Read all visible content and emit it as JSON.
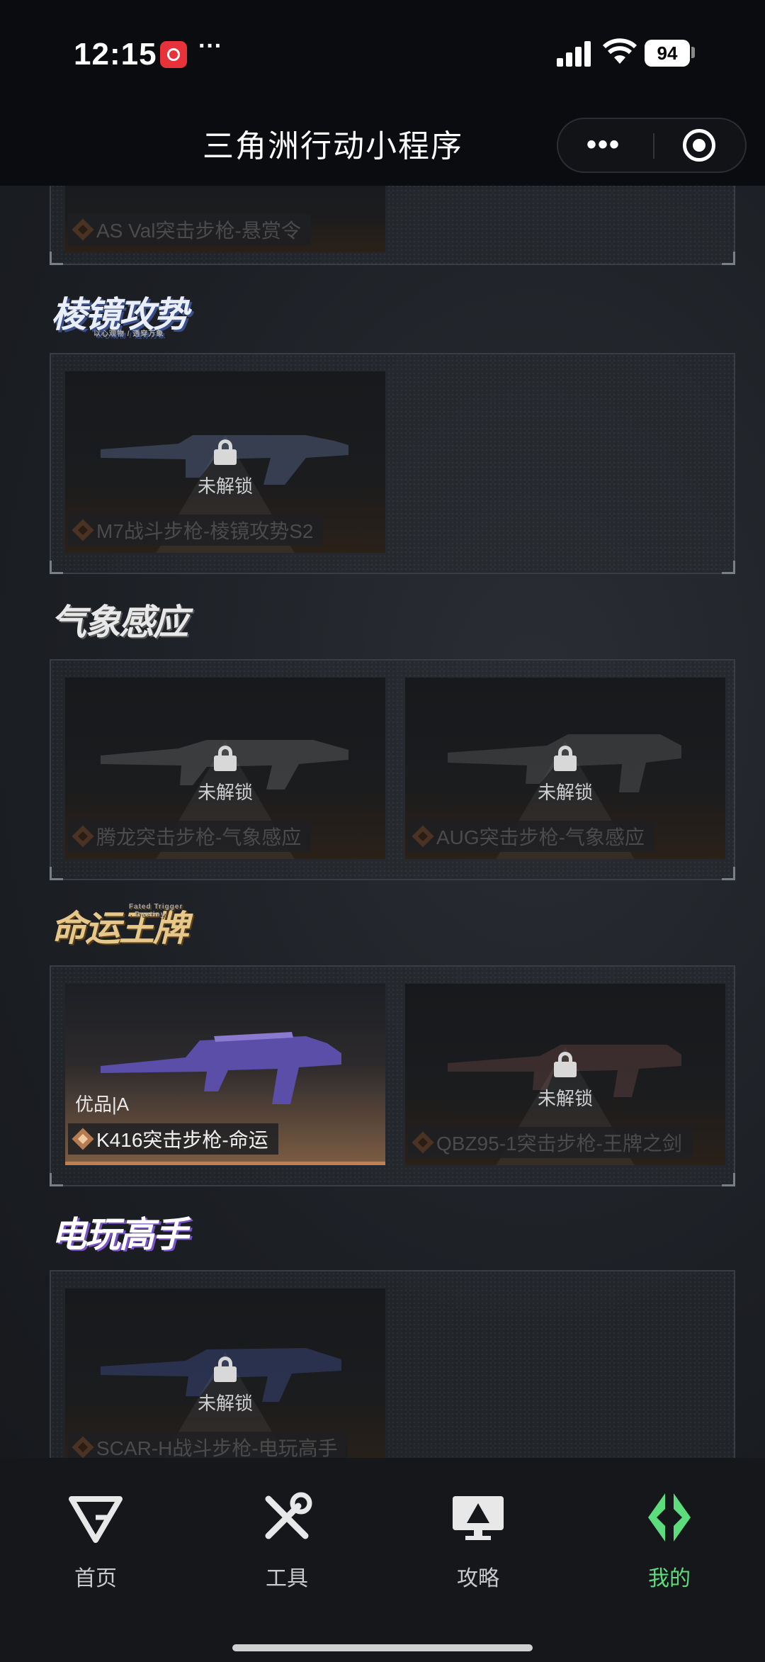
{
  "status_bar": {
    "time": "12:15",
    "more": "···",
    "battery": "94"
  },
  "nav": {
    "title": "三角洲行动小程序",
    "more": "•••"
  },
  "sections": [
    {
      "logo": "",
      "cards": [
        {
          "name": "AS Val突击步枪-悬赏令",
          "locked": true
        }
      ]
    },
    {
      "logo": "棱镜攻势",
      "logo_sub": "以心观物 / 透穿万象",
      "cards": [
        {
          "name": "M7战斗步枪-棱镜攻势S2",
          "locked": true,
          "status": "未解锁"
        }
      ]
    },
    {
      "logo": "气象感应",
      "cards": [
        {
          "name": "腾龙突击步枪-气象感应",
          "locked": true,
          "status": "未解锁"
        },
        {
          "name": "AUG突击步枪-气象感应",
          "locked": true,
          "status": "未解锁"
        }
      ]
    },
    {
      "logo": "命运王牌",
      "logo_sub": "Fated Trigger · Destiny",
      "cards": [
        {
          "name": "K416突击步枪-命运",
          "locked": false,
          "grade": "优品|A"
        },
        {
          "name": "QBZ95-1突击步枪-王牌之剑",
          "locked": true,
          "status": "未解锁"
        }
      ]
    },
    {
      "logo": "电玩高手",
      "cards": [
        {
          "name": "SCAR-H战斗步枪-电玩高手",
          "locked": true,
          "status": "未解锁"
        }
      ]
    }
  ],
  "tabbar": {
    "items": [
      {
        "label": "首页",
        "icon": "home-logo-icon"
      },
      {
        "label": "工具",
        "icon": "tools-icon"
      },
      {
        "label": "攻略",
        "icon": "guide-monitor-icon"
      },
      {
        "label": "我的",
        "icon": "profile-logo-icon",
        "active": true
      }
    ]
  },
  "colors": {
    "active_tab": "#5ddc7e",
    "background": "#1e2126",
    "bar": "#0a0c0f"
  }
}
